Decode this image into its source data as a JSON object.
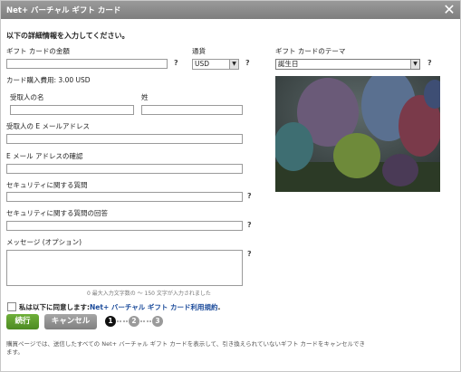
{
  "window": {
    "title": "Net+ バーチャル ギフト カード"
  },
  "form": {
    "heading": "以下の詳細情報を入力してください。",
    "amount_label": "ギフト カードの金額",
    "currency_label": "通貨",
    "currency_value": "USD",
    "theme_label": "ギフト カードのテーマ",
    "theme_value": "誕生日",
    "fee_text": "カード購入費用: 3.00 USD",
    "recipient_first_label": "受取人の名",
    "recipient_last_label": "姓",
    "email_label": "受取人の E メールアドレス",
    "email_confirm_label": "E メール アドレスの確認",
    "security_question_label": "セキュリティに関する質問",
    "security_answer_label": "セキュリティに関する質問の回答",
    "message_label": "メッセージ (オプション)",
    "char_counter": "0 最大入力文字数の ～ 150 文字が入力されました",
    "agree_prefix": "私は以下に同意します:",
    "agree_link": "Net+ バーチャル ギフト カード利用規約",
    "agree_suffix": ".",
    "help_mark": "?"
  },
  "buttons": {
    "continue": "続行",
    "cancel": "キャンセル"
  },
  "steps": [
    "1",
    "2",
    "3"
  ],
  "footer_note": "購買ページでは、送信したすべての Net+ バーチャル ギフト カードを表示して、引き換えられていないギフト カードをキャンセルできます。",
  "colors": {
    "titlebar": "#8a8a8a",
    "continue": "#5a9a2a",
    "cancel": "#8f8f8f",
    "step_active": "#111111",
    "step_inactive": "#9a9a9a",
    "link": "#1a4a9a"
  }
}
